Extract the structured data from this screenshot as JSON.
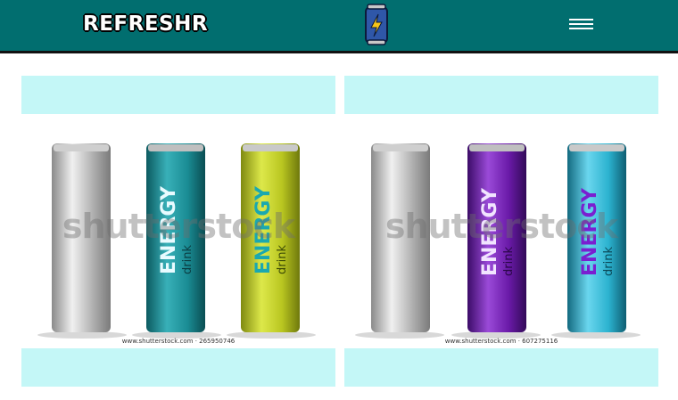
{
  "header": {
    "brand": "REFRESHR",
    "logo_icon": "energy-can-lightning-icon",
    "menu_icon": "hamburger-menu-icon",
    "colors": {
      "navbar": "#016e6f",
      "accent_bar": "#c4f7f7"
    }
  },
  "cards": [
    {
      "watermark": "shutterstock",
      "caption": "www.shutterstock.com · 265950746",
      "cans": [
        {
          "label": "",
          "sub": "",
          "color": "#c9c9c9"
        },
        {
          "label": "ENERGY",
          "sub": "drink",
          "color": "#1a8c94"
        },
        {
          "label": "ENERGY",
          "sub": "drink",
          "color": "#b9c620"
        }
      ]
    },
    {
      "watermark": "shutterstock",
      "caption": "www.shutterstock.com · 607275116",
      "cans": [
        {
          "label": "",
          "sub": "",
          "color": "#c9c9c9"
        },
        {
          "label": "ENERGY",
          "sub": "drink",
          "color": "#6a1aa8"
        },
        {
          "label": "ENERGY",
          "sub": "drink",
          "color": "#2bb2cf"
        }
      ]
    }
  ]
}
